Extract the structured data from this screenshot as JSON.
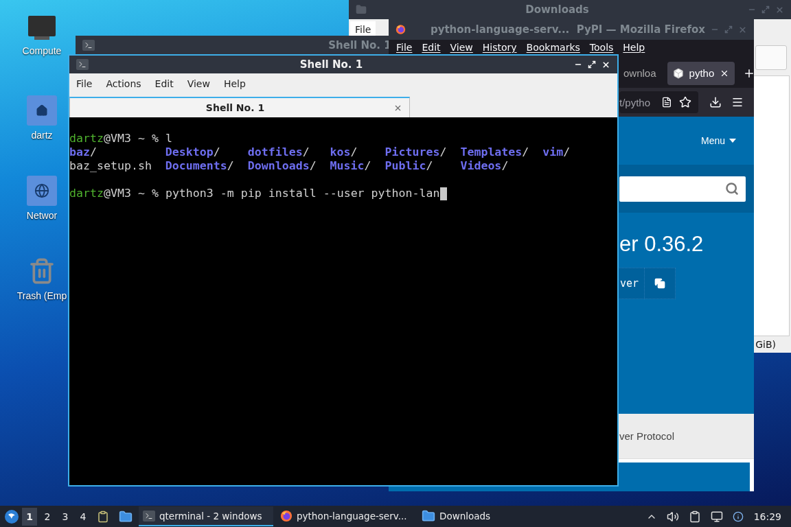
{
  "desktop_icons": [
    {
      "kind": "computer",
      "label": "Compute"
    },
    {
      "kind": "home",
      "label": "dartz"
    },
    {
      "kind": "network",
      "label": "Networ"
    },
    {
      "kind": "trash",
      "label": "Trash (Emp"
    }
  ],
  "downloads_window": {
    "title": "Downloads",
    "menu": [
      "File"
    ],
    "status": "GiB)"
  },
  "back_terminal": {
    "title": "Shell No. 1"
  },
  "firefox_window": {
    "title": "python-language-serv...  PyPI — Mozilla Firefox",
    "menu": [
      "File",
      "Edit",
      "View",
      "History",
      "Bookmarks",
      "Tools",
      "Help"
    ],
    "tabs": [
      {
        "label": "ownloa",
        "selected": false
      },
      {
        "label": "pytho",
        "selected": true
      }
    ],
    "url": "t/pytho",
    "page": {
      "menu_label": "Menu",
      "heading": "er 0.36.2",
      "pip_command": "ver",
      "summary": "ver Protocol"
    }
  },
  "terminal": {
    "title": "Shell No. 1",
    "menu": [
      "File",
      "Actions",
      "Edit",
      "View",
      "Help"
    ],
    "tabs": [
      {
        "label": "Shell No. 1",
        "selected": true
      }
    ],
    "lines": [
      {
        "kind": "prompt",
        "user": "dartz",
        "host": "@VM3 ~ %",
        "command": "l",
        "cursor": false
      },
      {
        "kind": "listing",
        "entries": [
          {
            "name": "baz",
            "suffix": "/",
            "kind": "dir"
          },
          {
            "name": "Desktop",
            "suffix": "/",
            "kind": "dir"
          },
          {
            "name": "dotfiles",
            "suffix": "/",
            "kind": "dir"
          },
          {
            "name": "kos",
            "suffix": "/",
            "kind": "dir"
          },
          {
            "name": "Pictures",
            "suffix": "/",
            "kind": "dir"
          },
          {
            "name": "Templates",
            "suffix": "/",
            "kind": "dir"
          },
          {
            "name": "vim",
            "suffix": "/",
            "kind": "dir"
          }
        ]
      },
      {
        "kind": "listing",
        "entries": [
          {
            "name": "baz_setup.sh",
            "kind": "file"
          },
          {
            "name": "Documents",
            "suffix": "/",
            "kind": "dir"
          },
          {
            "name": "Downloads",
            "suffix": "/",
            "kind": "dir"
          },
          {
            "name": "Music",
            "suffix": "/",
            "kind": "dir"
          },
          {
            "name": "Public",
            "suffix": "/",
            "kind": "dir"
          },
          {
            "name": "Videos",
            "suffix": "/",
            "kind": "dir"
          }
        ]
      },
      {
        "kind": "blank"
      },
      {
        "kind": "prompt",
        "user": "dartz",
        "host": "@VM3 ~ %",
        "command": "python3 -m pip install --user python-lan",
        "cursor": true
      }
    ]
  },
  "taskbar": {
    "workspaces": [
      {
        "label": "1",
        "selected": true
      },
      {
        "label": "2",
        "selected": false
      },
      {
        "label": "3",
        "selected": false
      },
      {
        "label": "4",
        "selected": false
      }
    ],
    "tasks": [
      {
        "kind": "terminal",
        "label": "qterminal - 2 windows",
        "selected": true
      },
      {
        "kind": "firefox",
        "label": "python-language-serv...",
        "selected": false
      },
      {
        "kind": "folder",
        "label": "Downloads",
        "selected": false
      }
    ],
    "clock": "16:29"
  }
}
